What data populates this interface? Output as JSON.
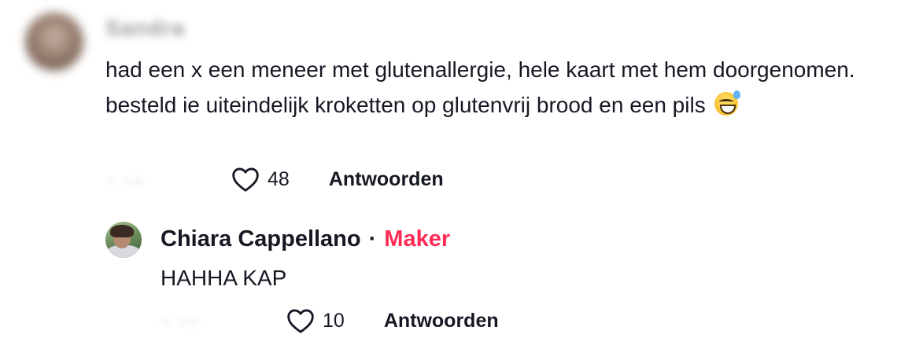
{
  "main_comment": {
    "username": "Sandra",
    "text": "had een x een meneer met glutenallergie, hele kaart met hem doorgenomen. besteld ie uiteindelijk kroketten op glutenvrij brood en een pils",
    "emoji_icon": "grinning-face-with-sweat-icon",
    "date": "2-27",
    "likes": "48",
    "reply_label": "Antwoorden"
  },
  "reply_comment": {
    "username": "Chiara Cappellano",
    "separator": "·",
    "badge": "Maker",
    "badge_color": "#fe2c55",
    "text": "HAHHA KAP",
    "date": "2-27",
    "likes": "10",
    "reply_label": "Antwoorden"
  }
}
